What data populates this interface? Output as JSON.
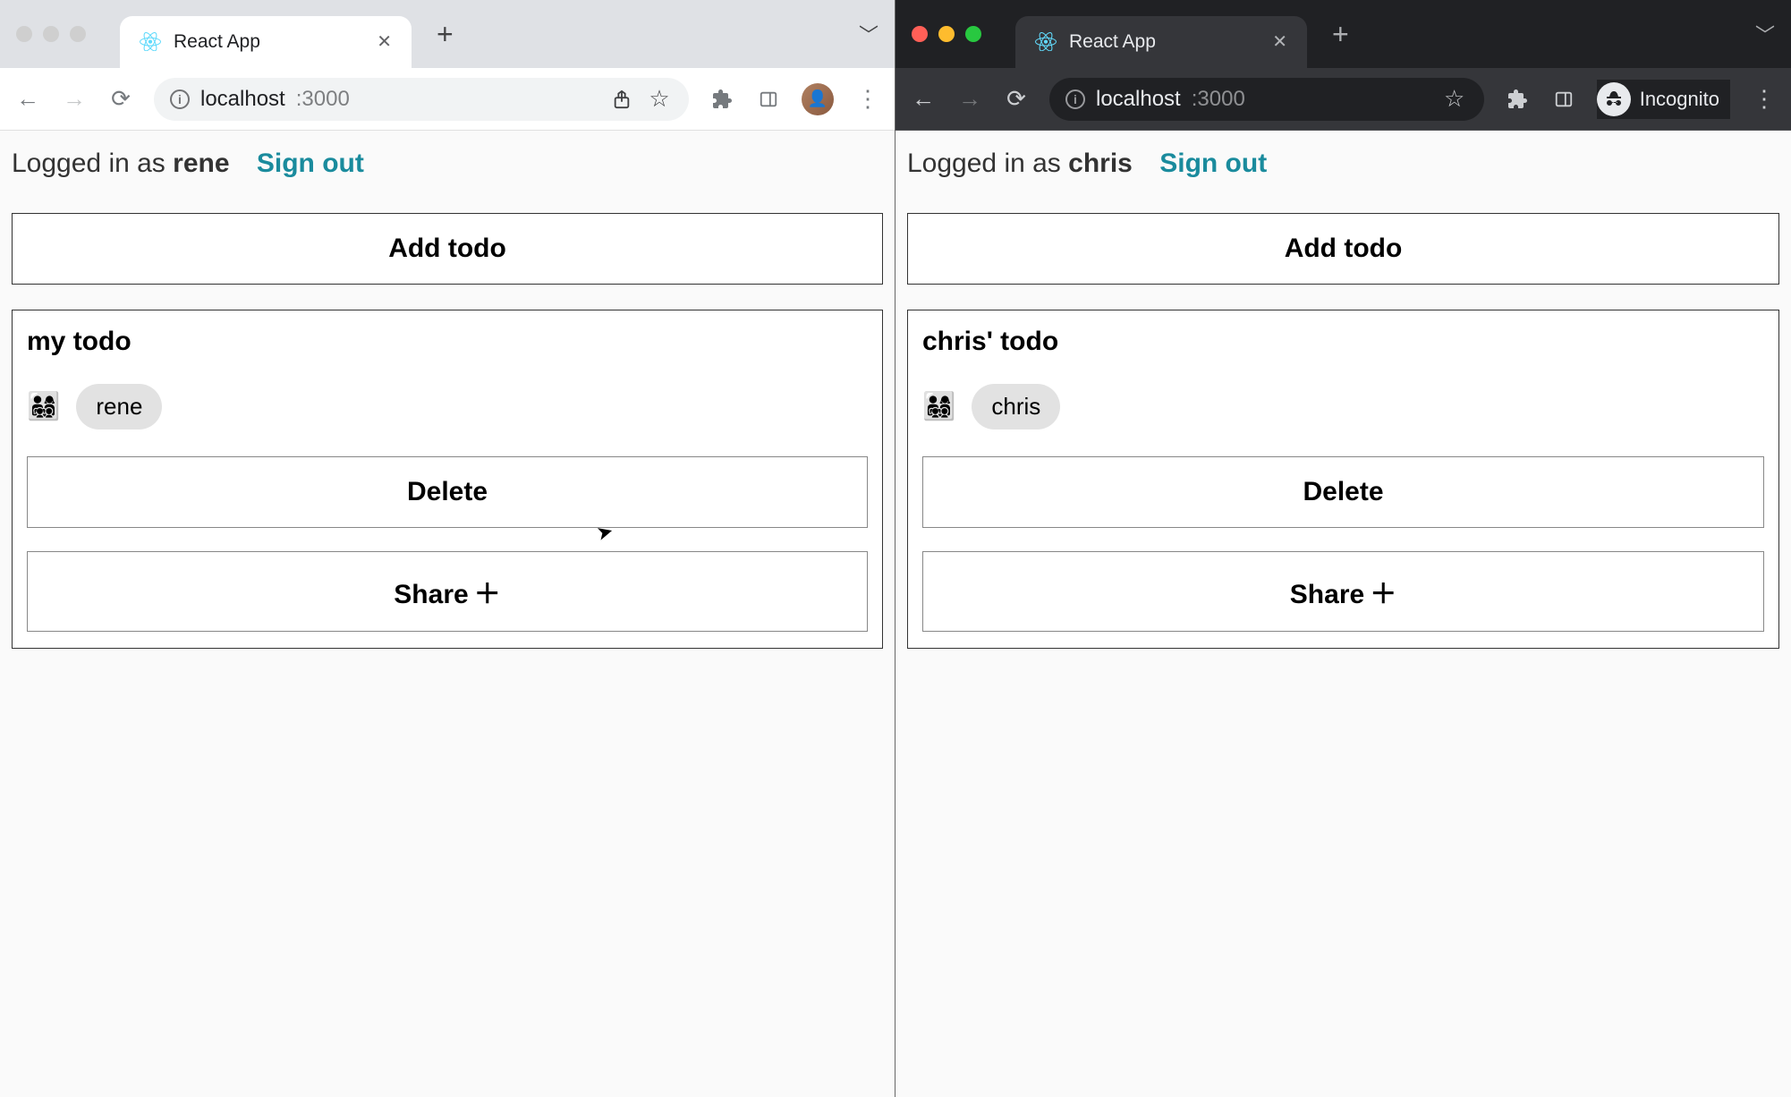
{
  "windows": [
    {
      "theme": "light",
      "traffic_state": "inactive",
      "tab_title": "React App",
      "url_host": "localhost",
      "url_path": ":3000",
      "toolbar_mode": "default",
      "avatar_label": "user-avatar",
      "incognito_label": "",
      "userline_prefix": "Logged in as ",
      "username": "rene",
      "signout_label": "Sign out",
      "add_todo_label": "Add todo",
      "todo": {
        "title": "my todo",
        "family_emoji": "👨‍👩‍👧‍👦",
        "member": "rene",
        "delete_label": "Delete",
        "share_label": "Share",
        "share_plus": "＋"
      }
    },
    {
      "theme": "dark",
      "traffic_state": "active",
      "tab_title": "React App",
      "url_host": "localhost",
      "url_path": ":3000",
      "toolbar_mode": "incognito",
      "avatar_label": "",
      "incognito_label": "Incognito",
      "userline_prefix": "Logged in as ",
      "username": "chris",
      "signout_label": "Sign out",
      "add_todo_label": "Add todo",
      "todo": {
        "title": "chris' todo",
        "family_emoji": "👨‍👩‍👧‍👦",
        "member": "chris",
        "delete_label": "Delete",
        "share_label": "Share",
        "share_plus": "＋"
      }
    }
  ]
}
